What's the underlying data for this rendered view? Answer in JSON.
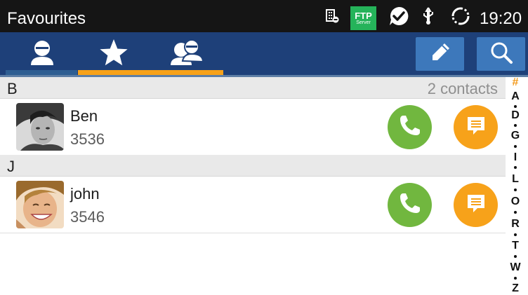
{
  "status_bar": {
    "title": "Favourites",
    "ftp_label": "FTP",
    "ftp_sub_label": "Server",
    "time": "19:20",
    "icons": [
      "phonebook-icon",
      "ftp-server-icon",
      "check-bubble-icon",
      "usb-icon",
      "sync-icon"
    ]
  },
  "tabs": [
    {
      "name": "contacts",
      "icon": "person-icon",
      "selected": false
    },
    {
      "name": "favourites",
      "icon": "star-icon",
      "selected": true
    },
    {
      "name": "groups",
      "icon": "group-icon",
      "selected": false
    }
  ],
  "actions": [
    {
      "name": "edit",
      "icon": "pencil-icon"
    },
    {
      "name": "search",
      "icon": "magnifier-icon"
    }
  ],
  "sections": [
    {
      "letter": "B",
      "count_label": "2 contacts",
      "contacts": [
        {
          "name": "Ben",
          "number": "3536"
        }
      ]
    },
    {
      "letter": "J",
      "count_label": "",
      "contacts": [
        {
          "name": "john",
          "number": "3546"
        }
      ]
    }
  ],
  "index": [
    "#",
    "A",
    "D",
    "G",
    "I",
    "L",
    "O",
    "R",
    "T",
    "W",
    "Z"
  ],
  "colors": {
    "status_bar": "#151515",
    "tab_bar": "#1e4079",
    "tab_indicator": "#f7a21a",
    "action_button": "#3d78bb",
    "call": "#71b73f",
    "message": "#f7a21a",
    "section_bg": "#e9e9e9",
    "index_hash": "#f39a1b"
  }
}
